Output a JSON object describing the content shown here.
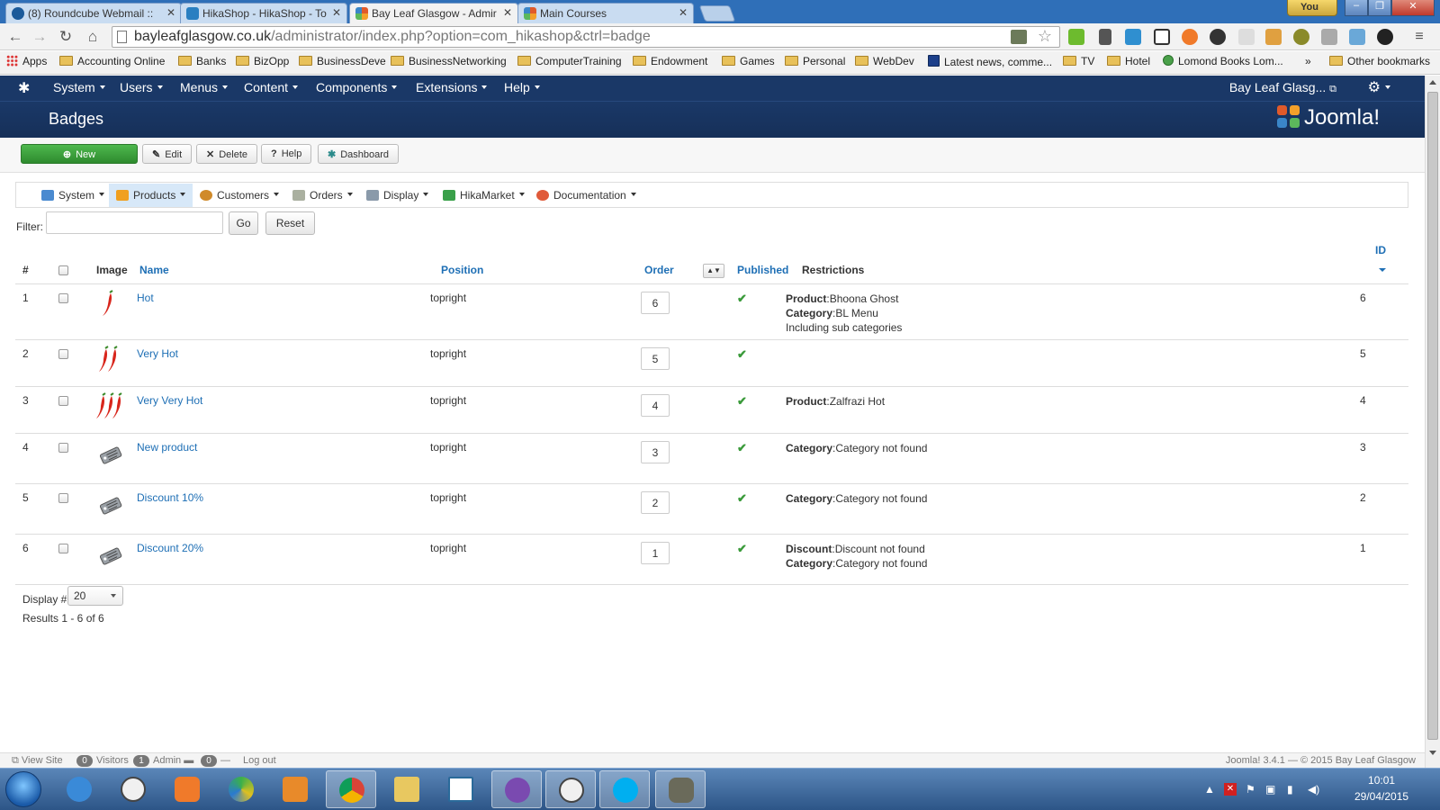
{
  "browser": {
    "tabs": [
      {
        "title": "(8) Roundcube Webmail ::",
        "active": false
      },
      {
        "title": "HikaShop - HikaShop - To",
        "active": false
      },
      {
        "title": "Bay Leaf Glasgow - Admir",
        "active": true
      },
      {
        "title": "Main Courses",
        "active": false
      }
    ],
    "user_badge": "You",
    "url_host": "bayleafglasgow.co.uk",
    "url_path": "/administrator/index.php?option=com_hikashop&ctrl=badge",
    "bookmarks": [
      {
        "label": "Apps",
        "icon": "apps-grid-icon"
      },
      {
        "label": "Accounting Online",
        "icon": "folder-icon"
      },
      {
        "label": "Banks",
        "icon": "folder-icon"
      },
      {
        "label": "BizOpp",
        "icon": "folder-icon"
      },
      {
        "label": "BusinessDeve",
        "icon": "folder-icon"
      },
      {
        "label": "BusinessNetworking",
        "icon": "folder-icon"
      },
      {
        "label": "ComputerTraining",
        "icon": "folder-icon"
      },
      {
        "label": "Endowment",
        "icon": "folder-icon"
      },
      {
        "label": "Games",
        "icon": "folder-icon"
      },
      {
        "label": "Personal",
        "icon": "folder-icon"
      },
      {
        "label": "WebDev",
        "icon": "folder-icon"
      },
      {
        "label": "Latest news, comme...",
        "icon": "news-site-icon"
      },
      {
        "label": "TV",
        "icon": "folder-icon"
      },
      {
        "label": "Hotel",
        "icon": "folder-icon"
      },
      {
        "label": "Lomond Books Lom...",
        "icon": "site-icon"
      },
      {
        "label": "»",
        "icon": ""
      },
      {
        "label": "Other bookmarks",
        "icon": "folder-icon"
      }
    ]
  },
  "joomla": {
    "menu": [
      "System",
      "Users",
      "Menus",
      "Content",
      "Components",
      "Extensions",
      "Help"
    ],
    "site_name": "Bay Leaf Glasg...",
    "page_title": "Badges",
    "brand": "Joomla!",
    "toolbar": {
      "new": "New",
      "edit": "Edit",
      "delete": "Delete",
      "help": "Help",
      "dashboard": "Dashboard"
    }
  },
  "hikamenu": [
    {
      "label": "System",
      "icon": "tools-icon",
      "active": false
    },
    {
      "label": "Products",
      "icon": "products-icon",
      "active": true
    },
    {
      "label": "Customers",
      "icon": "customers-icon",
      "active": false
    },
    {
      "label": "Orders",
      "icon": "orders-icon",
      "active": false
    },
    {
      "label": "Display",
      "icon": "display-icon",
      "active": false
    },
    {
      "label": "HikaMarket",
      "icon": "hikamarket-icon",
      "active": false
    },
    {
      "label": "Documentation",
      "icon": "lifebuoy-icon",
      "active": false
    }
  ],
  "filter": {
    "label": "Filter:",
    "value": "",
    "go": "Go",
    "reset": "Reset"
  },
  "table": {
    "headers": {
      "num": "#",
      "image": "Image",
      "name": "Name",
      "position": "Position",
      "order": "Order",
      "published": "Published",
      "restrictions": "Restrictions",
      "id": "ID"
    },
    "rows": [
      {
        "num": "1",
        "image": "chili-1-icon",
        "name": "Hot",
        "position": "topright",
        "order": "6",
        "published": true,
        "restrictions": [
          {
            "key": "Product",
            "value": "Bhoona Ghost"
          },
          {
            "key": "Category",
            "value": "BL Menu"
          },
          {
            "key": "",
            "value": "Including sub categories"
          }
        ],
        "id": "6"
      },
      {
        "num": "2",
        "image": "chili-2-icon",
        "name": "Very Hot",
        "position": "topright",
        "order": "5",
        "published": true,
        "restrictions": [],
        "id": "5"
      },
      {
        "num": "3",
        "image": "chili-3-icon",
        "name": "Very Very Hot",
        "position": "topright",
        "order": "4",
        "published": true,
        "restrictions": [
          {
            "key": "Product",
            "value": "Zalfrazi Hot"
          }
        ],
        "id": "4"
      },
      {
        "num": "4",
        "image": "price-tag-icon",
        "name": "New product",
        "position": "topright",
        "order": "3",
        "published": true,
        "restrictions": [
          {
            "key": "Category",
            "value": "Category not found"
          }
        ],
        "id": "3"
      },
      {
        "num": "5",
        "image": "price-tag-icon",
        "name": "Discount 10%",
        "position": "topright",
        "order": "2",
        "published": true,
        "restrictions": [
          {
            "key": "Category",
            "value": "Category not found"
          }
        ],
        "id": "2"
      },
      {
        "num": "6",
        "image": "price-tag-icon",
        "name": "Discount 20%",
        "position": "topright",
        "order": "1",
        "published": true,
        "restrictions": [
          {
            "key": "Discount",
            "value": "Discount not found"
          },
          {
            "key": "Category",
            "value": "Category not found"
          }
        ],
        "id": "1"
      }
    ]
  },
  "pagination": {
    "display_label": "Display #",
    "display_value": "20",
    "results": "Results 1 - 6 of 6"
  },
  "footer": {
    "view_site": "View Site",
    "visitors_count": "0",
    "visitors": "Visitors",
    "admin_count": "1",
    "admin": "Admin",
    "messages_count": "0",
    "logout": "Log out",
    "version": "Joomla! 3.4.1 — © 2015 Bay Leaf Glasgow"
  },
  "taskbar": {
    "time": "10:01",
    "date": "29/04/2015"
  },
  "colors": {
    "joomla_nav": "#1a3867",
    "link": "#1e6fb5",
    "new_button": "#3ba13b",
    "published_check": "#3a9a3a"
  }
}
